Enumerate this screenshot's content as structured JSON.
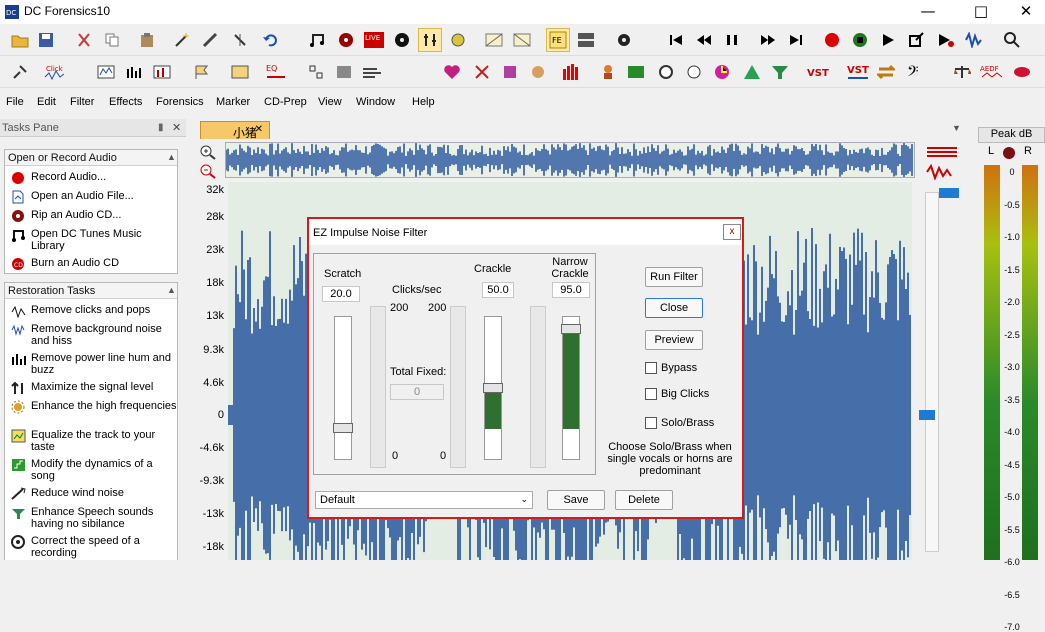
{
  "window": {
    "title": "DC Forensics10"
  },
  "menu": [
    "File",
    "Edit",
    "Filter",
    "Effects",
    "Forensics",
    "Marker",
    "CD-Prep",
    "View",
    "Window",
    "Help"
  ],
  "toolbar2_labels": {
    "click": "Click",
    "eq": "EQ",
    "live": "LIVE",
    "fe": "FE",
    "vst": "VST",
    "vst2": "VST",
    "aedf": "AEDF"
  },
  "tasks_pane": {
    "title": "Tasks Pane",
    "open_section": {
      "header": "Open or Record Audio",
      "items": [
        "Record Audio...",
        "Open an Audio File...",
        "Rip an Audio CD...",
        "Open DC Tunes Music Library",
        "Burn an Audio CD"
      ]
    },
    "restoration_section": {
      "header": "Restoration Tasks",
      "items": [
        "Remove clicks and pops",
        "Remove background noise and hiss",
        "Remove power line hum and buzz",
        "Maximize the signal level",
        "Enhance the high frequencies",
        "Equalize the track to your taste",
        "Modify the dynamics of a song",
        "Reduce wind noise",
        "Enhance Speech sounds having no sibilance",
        "Correct the speed of a recording"
      ]
    }
  },
  "document_tab": {
    "label": "小猪"
  },
  "amplitude_ruler": [
    "32k",
    "28k",
    "23k",
    "18k",
    "13k",
    "9.3k",
    "4.6k",
    "0",
    "-4.6k",
    "-9.3k",
    "-13k",
    "-18k"
  ],
  "peak_meter": {
    "title": "Peak dB",
    "left": "L",
    "right": "R",
    "scale": [
      "0",
      "-0.5",
      "-1.0",
      "-1.5",
      "-2.0",
      "-2.5",
      "-3.0",
      "-3.5",
      "-4.0",
      "-4.5",
      "-5.0",
      "-5.5",
      "-6.0",
      "-6.5",
      "-7.0"
    ]
  },
  "dialog": {
    "title": "EZ Impulse Noise Filter",
    "close_label": "x",
    "scratch": {
      "label": "Scratch",
      "value": "20.0"
    },
    "clicks_per_sec": {
      "label": "Clicks/sec",
      "top_left": "200",
      "top_right": "200",
      "bottom_left": "0",
      "bottom_right": "0"
    },
    "total_fixed": {
      "label": "Total Fixed:",
      "value": "0"
    },
    "crackle": {
      "label": "Crackle",
      "value": "50.0"
    },
    "narrow_crackle": {
      "label": "Narrow Crackle",
      "value": "95.0"
    },
    "buttons": {
      "run": "Run Filter",
      "close": "Close",
      "preview": "Preview",
      "save": "Save",
      "delete": "Delete"
    },
    "checkboxes": {
      "bypass": "Bypass",
      "big_clicks": "Big Clicks",
      "solo_brass": "Solo/Brass"
    },
    "note": "Choose Solo/Brass when single vocals or horns are predominant",
    "preset": {
      "selected": "Default"
    },
    "slider_levels": {
      "scratch": 0.2,
      "crackle": 0.5,
      "narrow_crackle": 0.95
    }
  },
  "colors": {
    "accent_red": "#d51a1a",
    "waveform": "#1f4f9c",
    "slider_fill": "#2f6f2f",
    "tab": "#f6c86a"
  }
}
